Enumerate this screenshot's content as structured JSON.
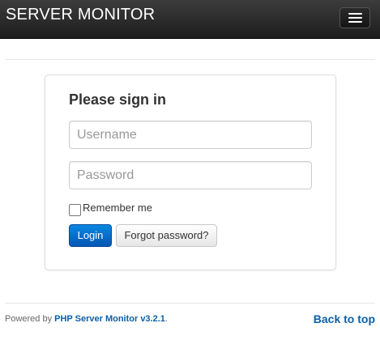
{
  "header": {
    "brand": "SERVER MONITOR",
    "menu_icon": "hamburger-menu-icon"
  },
  "login": {
    "title": "Please sign in",
    "username_placeholder": "Username",
    "password_placeholder": "Password",
    "remember_label": "Remember me",
    "remember_checked": false,
    "login_button": "Login",
    "forgot_button": "Forgot password?"
  },
  "footer": {
    "powered_by": "Powered by ",
    "product": "PHP Server Monitor v3.2.1",
    "period": ".",
    "back_to_top": "Back to top"
  },
  "colors": {
    "navbar": "#2a2a2a",
    "primary_button": "#0a6fd2",
    "link": "#0a5fa8"
  }
}
